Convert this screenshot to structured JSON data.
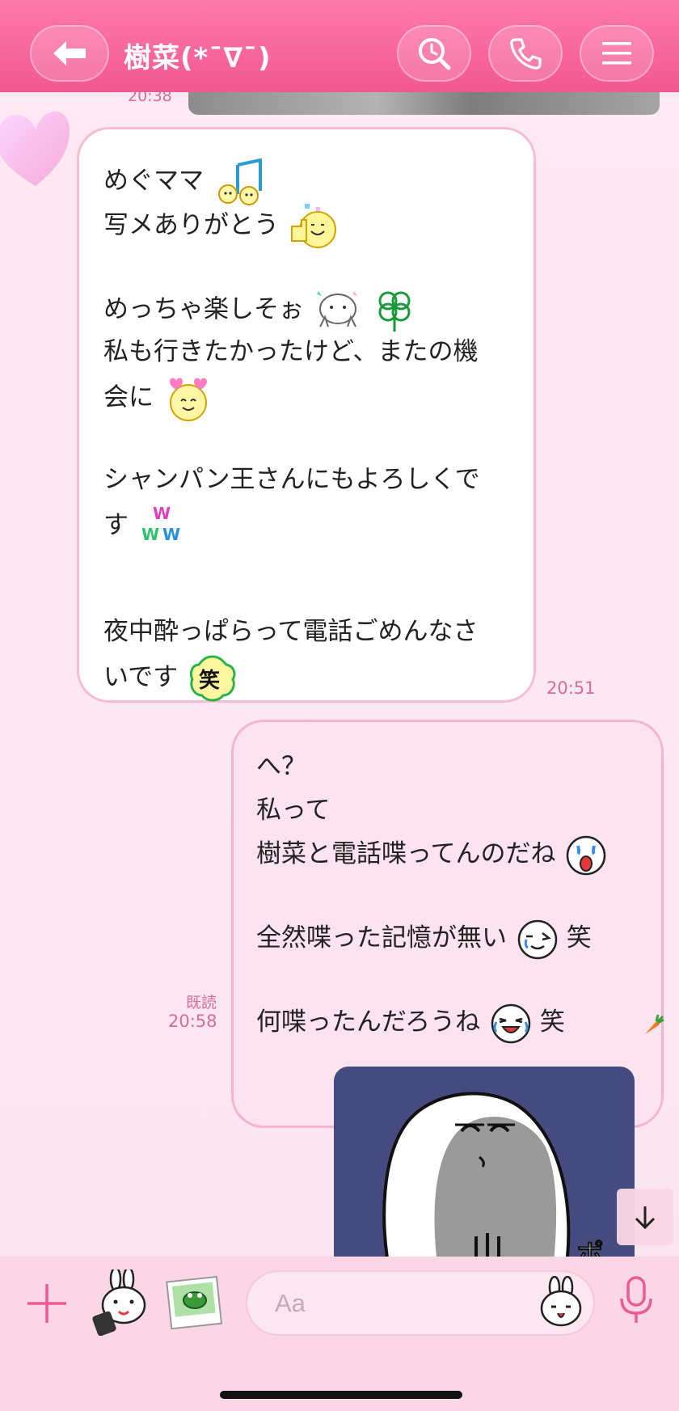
{
  "header": {
    "title": "樹菜(*¯∇¯)",
    "back_icon": "back-arrow-icon",
    "search_icon": "search-icon",
    "call_icon": "phone-icon",
    "menu_icon": "menu-icon",
    "accent": "#f2588f"
  },
  "previous": {
    "time": "20:38"
  },
  "incoming": {
    "lines": [
      "めぐママ",
      "写メありがとう",
      "めっちゃ楽しそぉ",
      "私も行きたかったけど、またの機",
      "会に",
      "シャンパン王さんにもよろしくで",
      "す",
      "夜中酔っぱらって電話ごめんなさ",
      "いです"
    ],
    "time": "20:51"
  },
  "outgoing": {
    "lines": [
      "へ？",
      "私って",
      "樹菜と電話喋ってんのだね",
      "全然喋った記憶が無い",
      "笑",
      "何喋ったんだろうね",
      "笑"
    ],
    "read_label": "既読",
    "time": "20:58"
  },
  "input": {
    "placeholder": "Aa"
  }
}
